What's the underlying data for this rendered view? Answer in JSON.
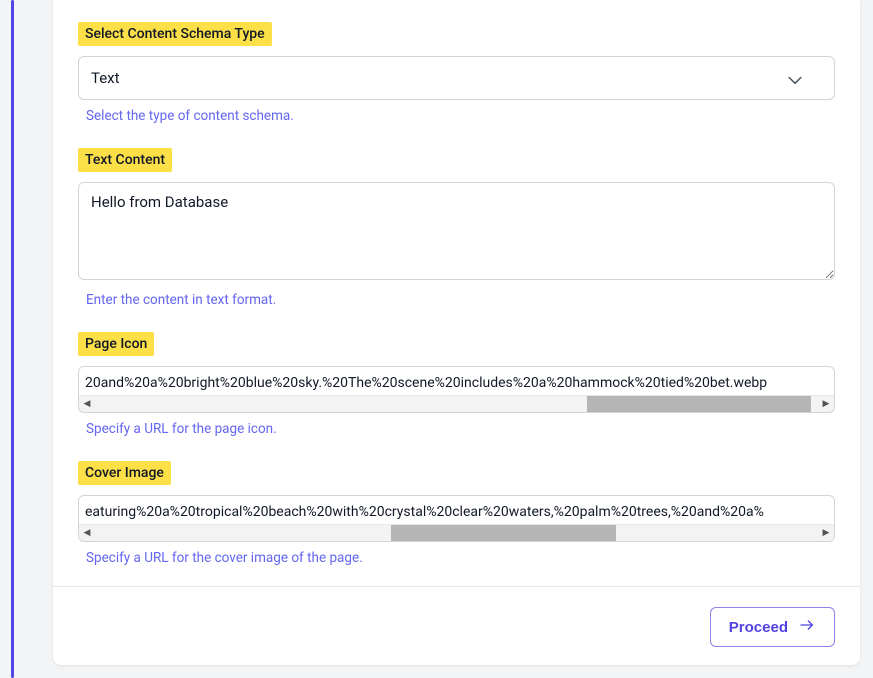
{
  "fields": {
    "schema_type": {
      "label": "Select Content Schema Type",
      "value": "Text",
      "helper": "Select the type of content schema."
    },
    "text_content": {
      "label": "Text Content",
      "value": "Hello from Database",
      "helper": "Enter the content in text format."
    },
    "page_icon": {
      "label": "Page Icon",
      "value_fragment": "20and%20a%20bright%20blue%20sky.%20The%20scene%20includes%20a%20hammock%20tied%20bet.webp",
      "helper": "Specify a URL for the page icon.",
      "scroll_thumb": {
        "left_pct": 68,
        "width_pct": 31
      }
    },
    "cover_image": {
      "label": "Cover Image",
      "value_fragment": "eaturing%20a%20tropical%20beach%20with%20crystal%20clear%20waters,%20palm%20trees,%20and%20a%",
      "helper": "Specify a URL for the cover image of the page.",
      "scroll_thumb": {
        "left_pct": 41,
        "width_pct": 31
      }
    }
  },
  "footer": {
    "proceed_label": "Proceed"
  }
}
